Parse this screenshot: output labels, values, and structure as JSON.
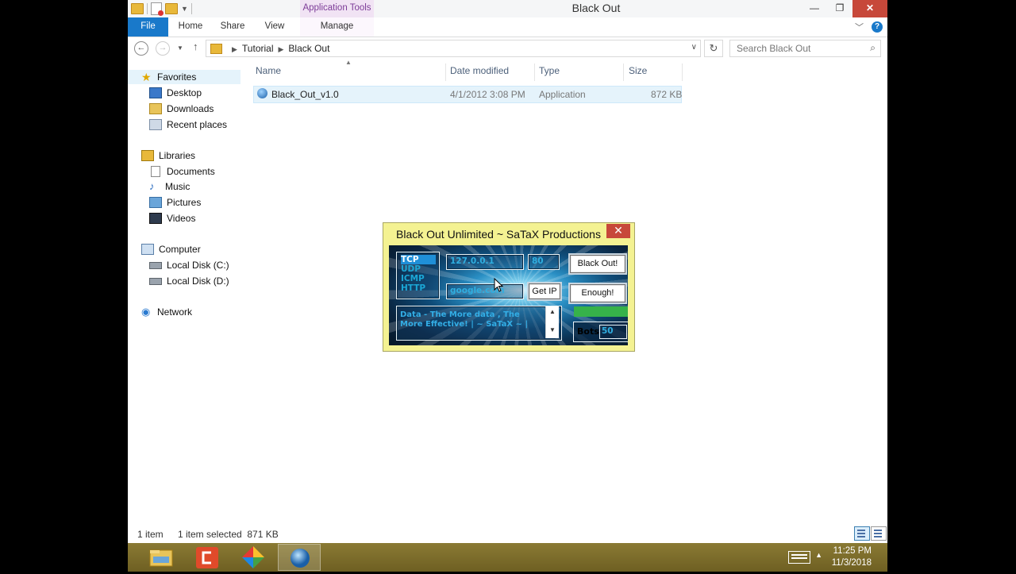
{
  "window": {
    "title": "Black Out",
    "context_tab": "Application Tools",
    "controls": {
      "minimize": "—",
      "maximize": "❐",
      "close": "✕"
    }
  },
  "ribbon": {
    "tabs": [
      "File",
      "Home",
      "Share",
      "View",
      "Manage"
    ],
    "help": "?"
  },
  "address": {
    "crumbs": [
      "Tutorial",
      "Black Out"
    ],
    "search_placeholder": "Search Black Out"
  },
  "nav": {
    "favorites": {
      "label": "Favorites",
      "items": [
        "Desktop",
        "Downloads",
        "Recent places"
      ]
    },
    "libraries": {
      "label": "Libraries",
      "items": [
        "Documents",
        "Music",
        "Pictures",
        "Videos"
      ]
    },
    "computer": {
      "label": "Computer",
      "items": [
        "Local Disk (C:)",
        "Local Disk (D:)"
      ]
    },
    "network": {
      "label": "Network"
    }
  },
  "columns": [
    "Name",
    "Date modified",
    "Type",
    "Size"
  ],
  "files": [
    {
      "name": "Black_Out_v1.0",
      "date": "4/1/2012 3:08 PM",
      "type": "Application",
      "size": "872 KB"
    }
  ],
  "status": {
    "count": "1 item",
    "selection": "1 item selected  871 KB"
  },
  "app": {
    "title": "Black Out Unlimited ~ SaTaX Productions",
    "close": "✕",
    "protocols": [
      "TCP",
      "UDP",
      "ICMP",
      "HTTP"
    ],
    "selected_protocol": "TCP",
    "ip": "127.0.0.1",
    "port": "80",
    "host": "google.com",
    "get_ip": "Get IP",
    "black_out": "Black Out!",
    "enough": "Enough!",
    "data": "Data - The More data , The More Effective!        | ~ SaTaX ~ |",
    "bots_label": "Bots",
    "bots_value": "50",
    "progress": 1.0
  },
  "taskbar": {
    "time": "11:25 PM",
    "date": "11/3/2018"
  },
  "colors": {
    "file_tab": "#1979ca",
    "close": "#c7483a",
    "context_tab": "#7d3c98",
    "app_frame": "#f4f292",
    "taskbar": "#7a6a28"
  }
}
